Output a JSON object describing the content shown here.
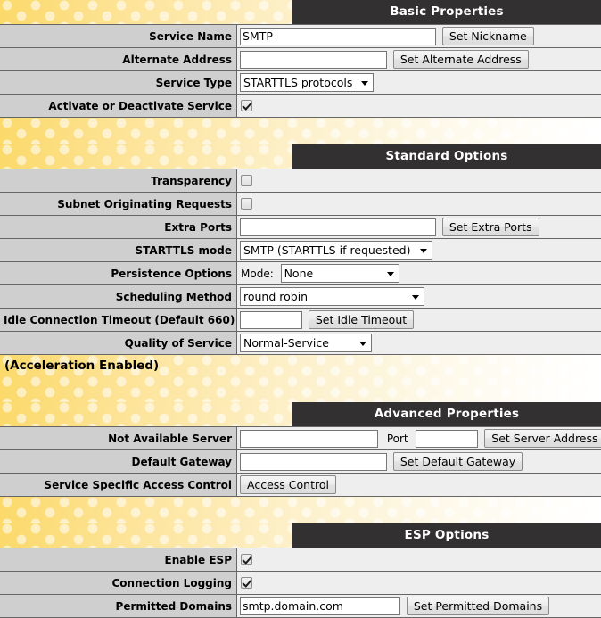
{
  "sections": [
    {
      "id": "basic",
      "title": "Basic Properties",
      "rows": [
        {
          "label": "Service Name",
          "input_value": "SMTP",
          "button": "Set Nickname"
        },
        {
          "label": "Alternate Address",
          "input_value": "",
          "button": "Set Alternate Address"
        },
        {
          "label": "Service Type",
          "select_value": "STARTTLS protocols"
        },
        {
          "label": "Activate or Deactivate Service",
          "checkbox": "checked"
        }
      ]
    },
    {
      "id": "standard",
      "title": "Standard Options",
      "rows": [
        {
          "label": "Transparency",
          "checkbox": "unchecked"
        },
        {
          "label": "Subnet Originating Requests",
          "checkbox": "unchecked"
        },
        {
          "label": "Extra Ports",
          "input_value": "",
          "button": "Set Extra Ports"
        },
        {
          "label": "STARTTLS mode",
          "select_value": "SMTP (STARTTLS if requested)"
        },
        {
          "label": "Persistence Options",
          "prefix": "Mode:",
          "select_value": "None"
        },
        {
          "label": "Scheduling Method",
          "select_value": "round robin"
        },
        {
          "label": "Idle Connection Timeout (Default 660)",
          "input_value": "",
          "button": "Set Idle Timeout"
        },
        {
          "label": "Quality of Service",
          "select_value": "Normal-Service"
        }
      ],
      "note": "(Acceleration Enabled)"
    },
    {
      "id": "advanced",
      "title": "Advanced Properties",
      "rows": [
        {
          "label": "Not Available Server",
          "input_value": "",
          "mid_label": "Port",
          "input2_value": "",
          "button": "Set Server Address"
        },
        {
          "label": "Default Gateway",
          "input_value": "",
          "button": "Set Default Gateway"
        },
        {
          "label": "Service Specific Access Control",
          "button_only": "Access Control"
        }
      ]
    },
    {
      "id": "esp",
      "title": "ESP Options",
      "rows": [
        {
          "label": "Enable ESP",
          "checkbox": "checked"
        },
        {
          "label": "Connection Logging",
          "checkbox": "checked"
        },
        {
          "label": "Permitted Domains",
          "input_value": "smtp.domain.com",
          "button": "Set Permitted Domains"
        }
      ]
    }
  ],
  "colors": {
    "title_bar": "#323031",
    "label_cell": "#cfcfcf",
    "value_cell": "#eeeeee",
    "gold_start": "#fbd96a",
    "gold_end": "#ffffff"
  }
}
